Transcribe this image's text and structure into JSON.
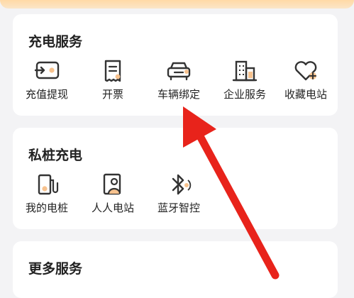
{
  "charging": {
    "title": "充电服务",
    "items": [
      {
        "label": "充值提现",
        "icon": "recharge-card-icon"
      },
      {
        "label": "开票",
        "icon": "invoice-icon"
      },
      {
        "label": "车辆绑定",
        "icon": "car-icon"
      },
      {
        "label": "企业服务",
        "icon": "building-icon"
      },
      {
        "label": "收藏电站",
        "icon": "heart-plus-icon"
      }
    ]
  },
  "private": {
    "title": "私桩充电",
    "items": [
      {
        "label": "我的电桩",
        "icon": "charger-pile-icon"
      },
      {
        "label": "人人电站",
        "icon": "person-station-icon"
      },
      {
        "label": "蓝牙智控",
        "icon": "bluetooth-icon"
      }
    ]
  },
  "more": {
    "title": "更多服务"
  },
  "colors": {
    "accent": "#f5a24a",
    "arrow": "#e8231b",
    "icon_stroke": "#333333"
  }
}
